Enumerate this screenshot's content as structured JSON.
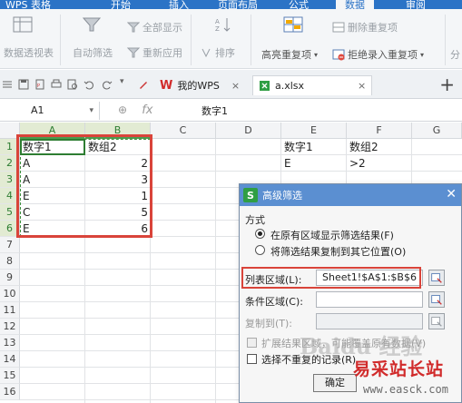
{
  "menubar": {
    "app_name": "WPS 表格",
    "menus": [
      "开始",
      "插入",
      "页面布局",
      "公式",
      "数据",
      "审阅"
    ],
    "active_menu": "数据"
  },
  "ribbon": {
    "pivot_table": "数据透视表",
    "auto_filter": "自动筛选",
    "show_all": "全部显示",
    "reapply": "重新应用",
    "sort": "排序",
    "highlight_duplicates": "高亮重复项",
    "delete_duplicates": "删除重复项",
    "reject_duplicates": "拒绝录入重复项",
    "split": "分"
  },
  "tabs": [
    {
      "label": "我的WPS"
    },
    {
      "label": "a.xlsx"
    }
  ],
  "formula_bar": {
    "name_box": "A1",
    "fx": "fx",
    "value": "数字1"
  },
  "columns": [
    "A",
    "B",
    "C",
    "D",
    "E",
    "F",
    "G"
  ],
  "rows": [
    "1",
    "2",
    "3",
    "4",
    "5",
    "6",
    "7",
    "8",
    "9",
    "10",
    "11",
    "12",
    "13",
    "14",
    "15",
    "16"
  ],
  "sheet": {
    "A1": "数字1",
    "B1": "数组2",
    "A2": "A",
    "B2": "2",
    "A3": "A",
    "B3": "3",
    "A4": "E",
    "B4": "1",
    "A5": "C",
    "B5": "5",
    "A6": "E",
    "B6": "6",
    "E1": "数字1",
    "F1": "数组2",
    "E2": "E",
    "F2": ">2"
  },
  "dialog": {
    "title": "高级筛选",
    "section_label": "方式",
    "option1": "在原有区域显示筛选结果(F)",
    "option2": "将筛选结果复制到其它位置(O)",
    "list_range_label": "列表区域(L):",
    "list_range_value": "Sheet1!$A$1:$B$6",
    "criteria_label": "条件区域(C):",
    "criteria_value": "",
    "copy_to_label": "复制到(T):",
    "copy_to_value": "",
    "expand_label": "扩展结果区域，可能覆盖原有数据(V)",
    "unique_label": "选择不重复的记录(R)",
    "ok_label": "确定"
  },
  "watermark": {
    "baidu": "Baidu 经验",
    "site": "易采站长站",
    "url": "www.easck.com"
  },
  "colors": {
    "accent": "#2b73c6",
    "selection": "#2e7d32",
    "highlight_red": "#d9443a"
  }
}
